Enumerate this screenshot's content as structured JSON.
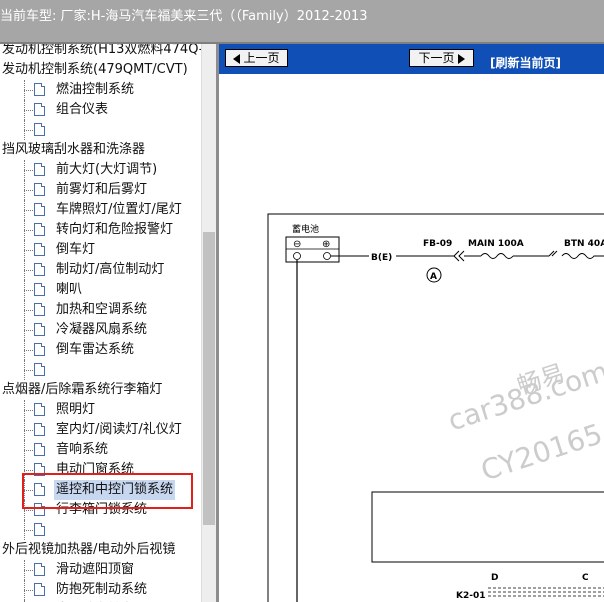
{
  "header": {
    "label": "当前车型:    厂家:H-海马汽车福美来三代（（Family）2012-2013"
  },
  "tree": {
    "rows": [
      {
        "type": "category",
        "text": "发动机控制系统(H13双燃料474Q-"
      },
      {
        "type": "category",
        "text": "发动机控制系统(479QMT/CVT)"
      },
      {
        "type": "item",
        "text": "燃油控制系统"
      },
      {
        "type": "item",
        "text": "组合仪表"
      },
      {
        "type": "item",
        "text": ""
      },
      {
        "type": "category",
        "text": "挡风玻璃刮水器和洗涤器"
      },
      {
        "type": "item",
        "text": "前大灯(大灯调节)"
      },
      {
        "type": "item",
        "text": "前雾灯和后雾灯"
      },
      {
        "type": "item",
        "text": "车牌照灯/位置灯/尾灯"
      },
      {
        "type": "item",
        "text": "转向灯和危险报警灯"
      },
      {
        "type": "item",
        "text": "倒车灯"
      },
      {
        "type": "item",
        "text": "制动灯/高位制动灯"
      },
      {
        "type": "item",
        "text": "喇叭"
      },
      {
        "type": "item",
        "text": "加热和空调系统"
      },
      {
        "type": "item",
        "text": "冷凝器风扇系统"
      },
      {
        "type": "item",
        "text": "倒车雷达系统"
      },
      {
        "type": "item",
        "text": ""
      },
      {
        "type": "category",
        "text": "点烟器/后除霜系统行李箱灯"
      },
      {
        "type": "item",
        "text": "照明灯"
      },
      {
        "type": "item",
        "text": "室内灯/阅读灯/礼仪灯"
      },
      {
        "type": "item",
        "text": "音响系统"
      },
      {
        "type": "item",
        "text": "电动门窗系统"
      },
      {
        "type": "item",
        "text": "遥控和中控门锁系统",
        "selected": true
      },
      {
        "type": "item",
        "text": "行李箱门锁系统"
      },
      {
        "type": "item",
        "text": ""
      },
      {
        "type": "category",
        "text": "外后视镜加热器/电动外后视镜"
      },
      {
        "type": "item",
        "text": "滑动遮阳顶窗"
      },
      {
        "type": "item",
        "text": "防抱死制动系统"
      },
      {
        "type": "item",
        "text": "电动助力转向(EPS)"
      }
    ]
  },
  "nav": {
    "prev_label": "上一页",
    "next_label": "下一页",
    "refresh_label": "[刷新当前页]"
  },
  "diagram": {
    "battery_label": "蓄电池",
    "minus_symbol": "⊖",
    "plus_symbol": "⊕",
    "connector_be": "B(E)",
    "fuse1": "FB-09",
    "fuse2": "MAIN 100A",
    "fuse3": "BTN 40A",
    "circle_a": "A",
    "terminal_d": "D",
    "terminal_c": "C",
    "connector_k": "K2-01"
  },
  "watermark": {
    "line1": "畅易",
    "line2": "car388.com",
    "line3": "CY20165"
  },
  "colors": {
    "header_bg": "#a6a6a6",
    "navbar_bg": "#0f4fb6",
    "selection_bg": "#c8d7f0",
    "highlight_box": "#e0201a"
  }
}
